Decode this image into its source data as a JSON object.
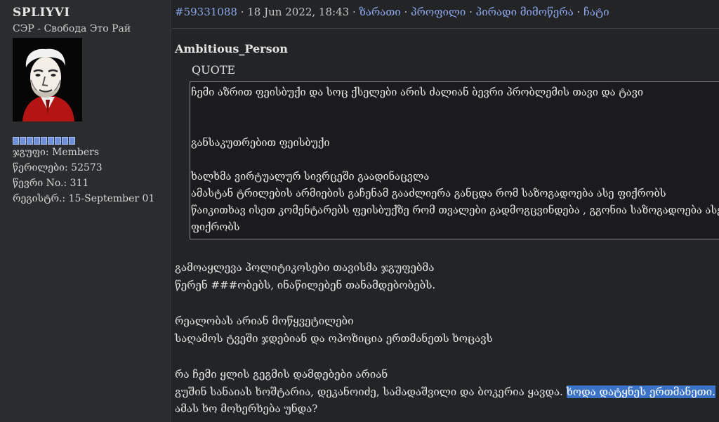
{
  "user": {
    "name": "SPLIYVI",
    "title": "СЭР - Свобода Это Рай",
    "rating_pips": 9,
    "stats": [
      {
        "label": "ჯგუფი:",
        "value": "Members"
      },
      {
        "label": "წერილები:",
        "value": "52573"
      },
      {
        "label": "წევრი No.:",
        "value": "311"
      },
      {
        "label": "რეგისტრ.:",
        "value": "15-September 01"
      }
    ]
  },
  "post": {
    "id": "#59331088",
    "date": "18 Jun 2022, 18:43",
    "links": [
      "ზარათი",
      "პროფილი",
      "პირადი მიმოწერა",
      "ჩატი"
    ],
    "separator": "·",
    "author": "Ambitious_Person",
    "quote_label": "QUOTE",
    "quote_lines": [
      "ჩემი აზრით ფეისბუქი და სოც ქსელები არის ძალიან ბევრი პრობლემის თავი და ტავი",
      "განსაკუთრებით ფეისბუქი",
      "ხალხმა ვირტუალურ სივრცეში გაადინაცვლა",
      "ამასტან ტრილების არმიების გაჩენამ გააძლიერა განცდა რომ საზოგადოება ასე ფიქრობს",
      "წაიკითხავ ისეთ კომენტარებს ფეისბუქზე რომ თვალები გადმოგცვინდება , გგონია საზოგადოება ასე",
      "ფიქრობს"
    ],
    "body_lines": [
      "გამოაყლევა პოლიტიკოსები თავისმა ჯგუფებმა",
      "წერენ ###ობებს, ინაწილებენ თანამდებობებს.",
      "რეალობას არიან მოწყვეტილები",
      "საღამოს ტვეში ჯდებიან და ოპოზიცია ერთმანეთს ხოცავს",
      "რა ჩემი ყლის გეგმის დამდებები არიან",
      "გუშინ სანაიას ხოშტარია, დეკანოიძე, სამადაშვილი და ბოკერია ყავდა.",
      "ხოდა დატყნეს ერთმანეთი.",
      "ამას ხო მოხერხება უნდა?"
    ]
  }
}
